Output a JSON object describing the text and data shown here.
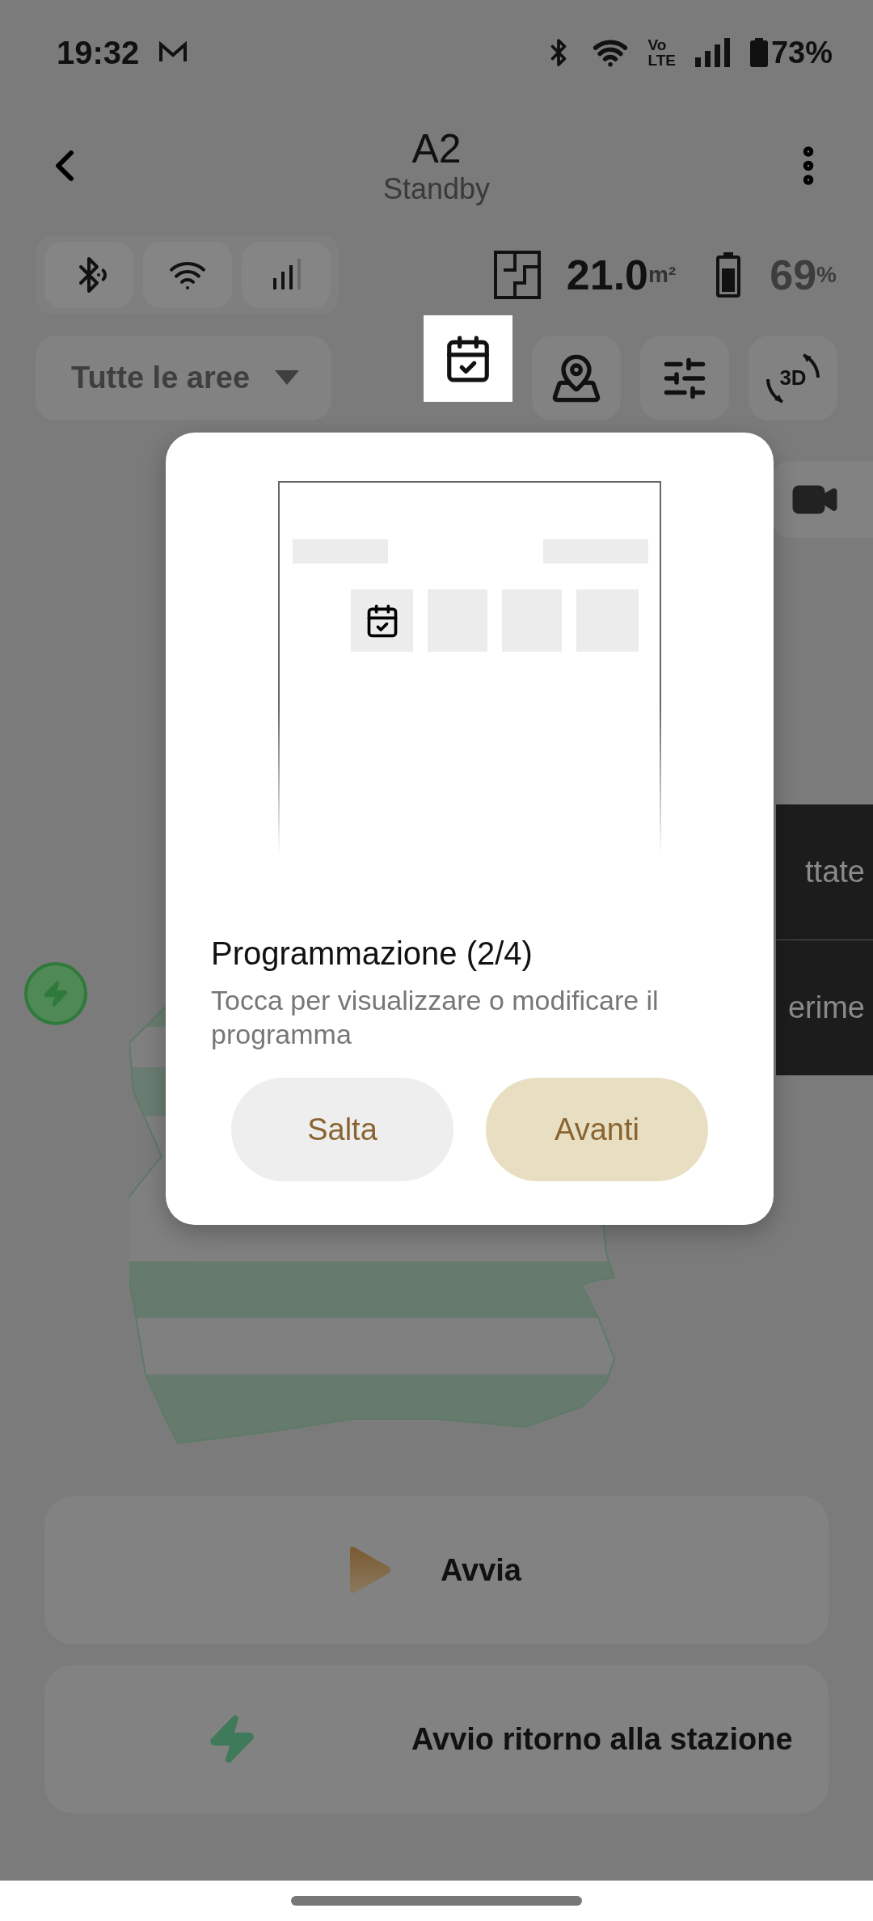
{
  "status_bar": {
    "time": "19:32",
    "network": [
      "Vo",
      "LTE"
    ],
    "battery": "73%"
  },
  "header": {
    "title": "A2",
    "subtitle": "Standby"
  },
  "stats": {
    "area": "21.0",
    "area_unit": "m²",
    "battery": "69",
    "battery_unit": "%"
  },
  "area_selector": {
    "value": "Tutte le aree"
  },
  "toolbar": [
    {
      "kind": "schedule",
      "highlighted": true
    },
    {
      "kind": "map",
      "highlighted": false
    },
    {
      "kind": "settings",
      "highlighted": false
    },
    {
      "kind": "view3d",
      "label": "3D",
      "highlighted": false
    }
  ],
  "side_panel": {
    "items": [
      "ttate",
      "erime"
    ]
  },
  "dialog": {
    "title": "Programmazione (2/4)",
    "description": "Tocca per visualizzare o modificare il programma",
    "buttons": [
      {
        "label": "Salta",
        "kind": "secondary"
      },
      {
        "label": "Avanti",
        "kind": "primary"
      }
    ]
  },
  "actions": [
    {
      "label": "Avvia",
      "kind": "start"
    },
    {
      "label": "Avvio ritorno alla stazione",
      "kind": "dock"
    }
  ]
}
